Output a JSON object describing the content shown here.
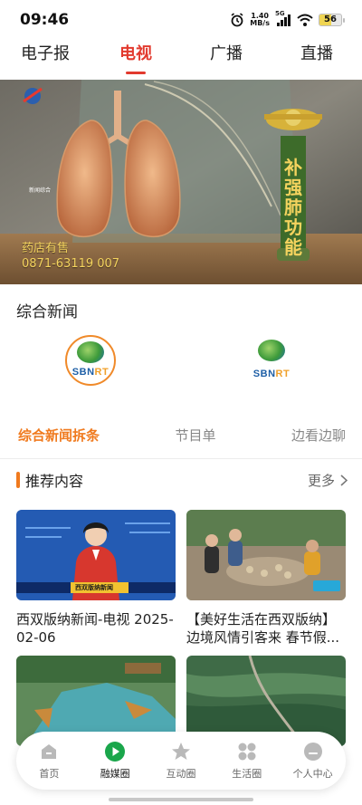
{
  "status_bar": {
    "time": "09:46",
    "net_speed_value": "1.40",
    "net_speed_unit": "MB/s",
    "network": "5G",
    "battery": "56",
    "battery_level": 0.56
  },
  "top_tabs": [
    {
      "label": "电子报",
      "active": false
    },
    {
      "label": "电视",
      "active": true
    },
    {
      "label": "广播",
      "active": false
    },
    {
      "label": "直播",
      "active": false
    }
  ],
  "banner": {
    "channel_label": "新闻综合",
    "caption_line1": "药店有售",
    "caption_line2": "0871-63119 007",
    "product_text": "补强肺功能"
  },
  "section_title": "综合新闻",
  "channels": [
    {
      "logo_main": "SBN",
      "logo_accent": "RT",
      "selected": true
    },
    {
      "logo_main": "SBN",
      "logo_accent": "RT",
      "selected": false
    }
  ],
  "sub_tabs": [
    {
      "label": "综合新闻拆条",
      "active": true
    },
    {
      "label": "节目单",
      "active": false
    },
    {
      "label": "边看边聊",
      "active": false
    }
  ],
  "recommend": {
    "title": "推荐内容",
    "more_label": "更多"
  },
  "cards": [
    {
      "title": "西双版纳新闻-电视 2025-02-06",
      "thumb_ticker": "西双版纳新闻"
    },
    {
      "title": "【美好生活在西双版纳】边境风情引客来 春节假...",
      "thumb_ticker": ""
    },
    {
      "title": "",
      "thumb_ticker": ""
    },
    {
      "title": "",
      "thumb_ticker": ""
    }
  ],
  "bottom_nav": [
    {
      "label": "首页",
      "icon": "home-icon",
      "active": false
    },
    {
      "label": "融媒圈",
      "icon": "play-icon",
      "active": true
    },
    {
      "label": "互动圈",
      "icon": "star-icon",
      "active": false
    },
    {
      "label": "生活圈",
      "icon": "grid-icon",
      "active": false
    },
    {
      "label": "个人中心",
      "icon": "user-icon",
      "active": false
    }
  ],
  "colors": {
    "accent_red": "#e23a2e",
    "accent_orange": "#f07a1e",
    "active_green": "#1aa64b"
  }
}
